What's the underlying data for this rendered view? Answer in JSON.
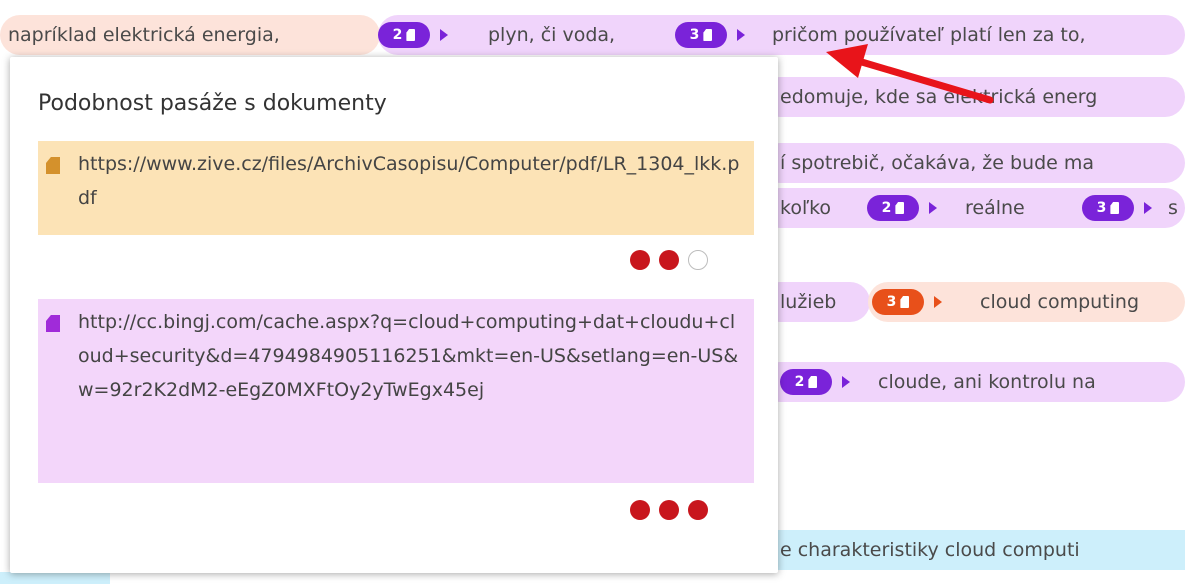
{
  "line1": {
    "seg1": "napríklad elektrická energia,",
    "seg2": "plyn, či voda,",
    "seg3": "pričom používateľ platí len za to,",
    "badge1": "2",
    "badge2": "3"
  },
  "line2": {
    "tail": "edomuje, kde sa elektrická energ"
  },
  "line3": {
    "tail": "í spotrebič, očakáva, že bude ma"
  },
  "line4": {
    "seg1": "koľko",
    "badge1": "2",
    "seg2": "reálne",
    "badge2": "3",
    "seg3": "s"
  },
  "line5": {
    "seg1": "lužieb",
    "badge1": "3",
    "seg2": "cloud computing"
  },
  "line6": {
    "badge1": "2",
    "seg1": "cloude, ani kontrolu na"
  },
  "line7": {
    "tail": "e charakteristiky cloud computi"
  },
  "popup": {
    "title": "Podobnost pasáže s dokumenty",
    "documents": [
      {
        "url": "https://www.zive.cz/files/ArchivCasopisu/Computer/pdf/LR_1304_lkk.pdf",
        "similarity_dots": 2,
        "max_dots": 3,
        "color": "#fce3b6"
      },
      {
        "url": "http://cc.bingj.com/cache.aspx?q=cloud+computing+dat+cloudu+cloud+security&d=4794984905116251&mkt=en-US&setlang=en-US&w=92r2K2dM2-eEgZ0MXFtOy2yTwEgx45ej",
        "similarity_dots": 3,
        "max_dots": 3,
        "color": "#f3d6fa"
      }
    ]
  },
  "colors": {
    "badge_purple": "#7a23d9",
    "badge_orange": "#e8501a",
    "arrow_red": "#e8141a",
    "dot_red": "#c8161d"
  }
}
